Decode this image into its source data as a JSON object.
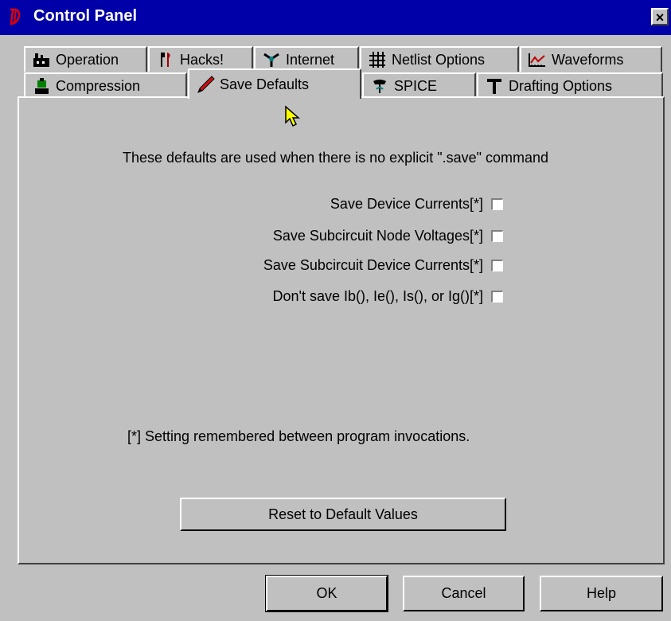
{
  "window": {
    "title": "Control Panel",
    "close": "×"
  },
  "tabs_row1": [
    {
      "label": "Operation",
      "icon": "factory-icon"
    },
    {
      "label": "Hacks!",
      "icon": "wrench-icon"
    },
    {
      "label": "Internet",
      "icon": "network-icon"
    },
    {
      "label": "Netlist Options",
      "icon": "grid-icon"
    },
    {
      "label": "Waveforms",
      "icon": "waveform-icon"
    }
  ],
  "tabs_row2": [
    {
      "label": "Compression",
      "icon": "compress-icon"
    },
    {
      "label": "Save Defaults",
      "icon": "pencil-icon",
      "active": true
    },
    {
      "label": "SPICE",
      "icon": "spice-icon"
    },
    {
      "label": "Drafting Options",
      "icon": "t-square-icon"
    }
  ],
  "panel": {
    "intro": "These defaults are used when there is no explicit \".save\" command",
    "options": [
      {
        "label": "Save Device Currents[*]",
        "checked": false
      },
      {
        "label": "Save Subcircuit Node Voltages[*]",
        "checked": false
      },
      {
        "label": "Save Subcircuit Device Currents[*]",
        "checked": false
      },
      {
        "label": "Don't save Ib(), Ie(), Is(), or Ig()[*]",
        "checked": false
      }
    ],
    "footnote": "[*] Setting remembered between program invocations.",
    "reset_label": "Reset to Default Values"
  },
  "buttons": {
    "ok": "OK",
    "cancel": "Cancel",
    "help": "Help"
  },
  "colors": {
    "titlebar": "#0000a8",
    "face": "#c0c0c0",
    "pencil": "#d01010",
    "cursor": "#ffff00"
  }
}
